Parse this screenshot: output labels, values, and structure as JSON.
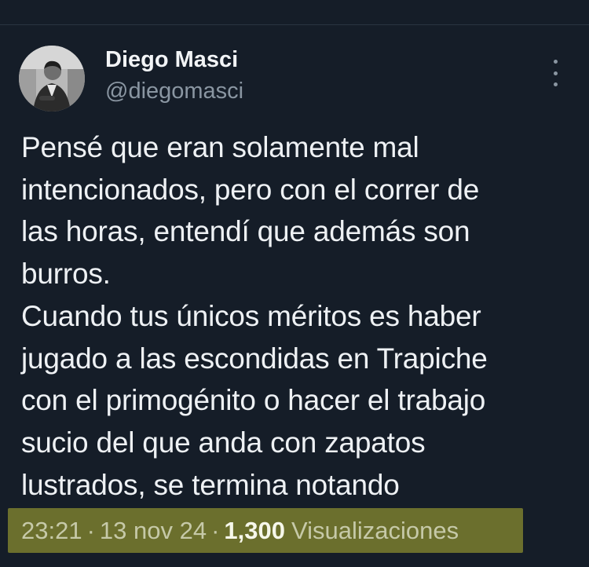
{
  "author": {
    "name": "Diego Masci",
    "handle": "@diegomasci"
  },
  "tweet": {
    "lines": [
      "Pensé que eran solamente mal",
      "intencionados, pero con el correr de",
      "las horas, entendí que además son",
      "burros.",
      "Cuando tus únicos méritos es haber",
      "jugado a las escondidas en Trapiche",
      "con el primogénito o hacer el trabajo",
      "sucio del que anda con zapatos",
      "lustrados, se termina notando"
    ]
  },
  "meta": {
    "time": "23:21",
    "separator": "·",
    "date": "13 nov 24",
    "views_count": "1,300",
    "views_label": "Visualizaciones"
  },
  "icons": {
    "more": "more-vertical-icon"
  },
  "colors": {
    "background": "#151d28",
    "text": "#eef1f4",
    "secondary_text": "#8a96a2",
    "highlight": "#6b6f2d"
  }
}
